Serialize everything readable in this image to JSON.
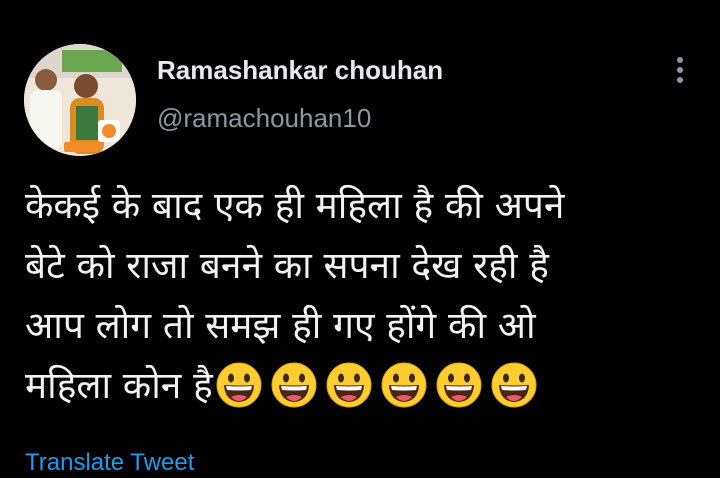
{
  "colors": {
    "background": "#000000",
    "name_text": "#e7e9ea",
    "handle_text": "#8b98a5",
    "body_text": "#f2f2f2",
    "link": "#1d9bf0"
  },
  "tweet": {
    "author": {
      "display_name": "Ramashankar chouhan",
      "handle": "@ramachouhan10",
      "avatar_icon": "profile-photo"
    },
    "more_icon": "more-vertical-icon",
    "text_lines": [
      "केकई के बाद एक ही महिला है की अपने",
      "बेटे को राजा बनने का सपना देख रही है",
      "आप लोग तो समझ ही गए होंगे की ओ",
      "महिला कोन है"
    ],
    "emoji_count": 6,
    "emoji_icon": "grinning-face-icon",
    "translate_label": "Translate Tweet"
  }
}
